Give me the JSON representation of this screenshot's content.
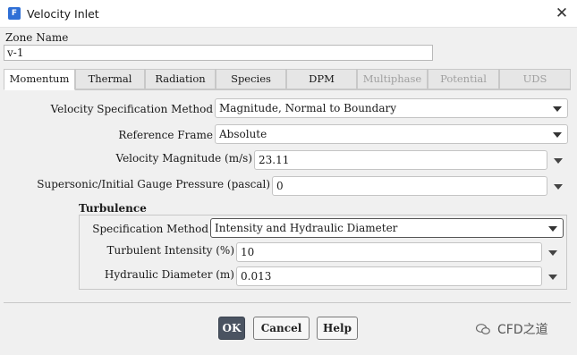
{
  "window": {
    "title": "Velocity Inlet",
    "app_icon_letter": "F",
    "close_glyph": "✕"
  },
  "zone": {
    "label": "Zone Name",
    "value": "v-1"
  },
  "tabs": [
    {
      "label": "Momentum",
      "active": true,
      "enabled": true
    },
    {
      "label": "Thermal",
      "active": false,
      "enabled": true
    },
    {
      "label": "Radiation",
      "active": false,
      "enabled": true
    },
    {
      "label": "Species",
      "active": false,
      "enabled": true
    },
    {
      "label": "DPM",
      "active": false,
      "enabled": true
    },
    {
      "label": "Multiphase",
      "active": false,
      "enabled": false
    },
    {
      "label": "Potential",
      "active": false,
      "enabled": false
    },
    {
      "label": "UDS",
      "active": false,
      "enabled": false
    }
  ],
  "momentum": {
    "velocity_spec_label": "Velocity Specification Method",
    "velocity_spec_value": "Magnitude, Normal to Boundary",
    "reference_frame_label": "Reference Frame",
    "reference_frame_value": "Absolute",
    "velocity_magnitude_label": "Velocity Magnitude (m/s)",
    "velocity_magnitude_value": "23.11",
    "pressure_label": "Supersonic/Initial Gauge Pressure (pascal)",
    "pressure_value": "0"
  },
  "turbulence": {
    "title": "Turbulence",
    "spec_method_label": "Specification Method",
    "spec_method_value": "Intensity and Hydraulic Diameter",
    "intensity_label": "Turbulent Intensity (%)",
    "intensity_value": "10",
    "diameter_label": "Hydraulic Diameter (m)",
    "diameter_value": "0.013"
  },
  "buttons": {
    "ok": "OK",
    "cancel": "Cancel",
    "help": "Help"
  },
  "watermark": {
    "text": "CFD之道"
  },
  "colors": {
    "accent": "#2f6fd6",
    "primary_button": "#4a5361"
  }
}
